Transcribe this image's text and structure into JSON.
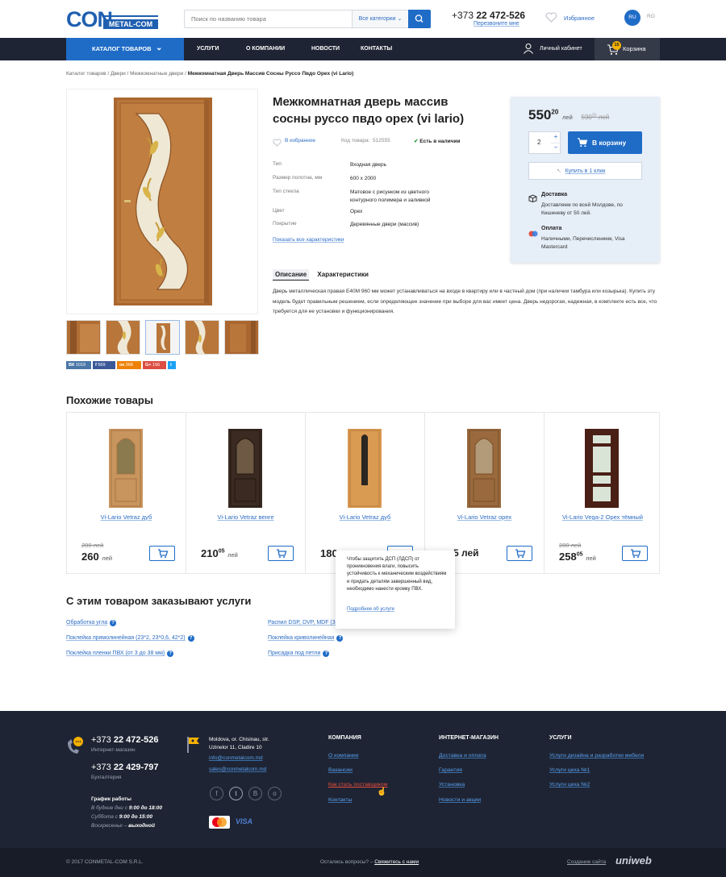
{
  "header": {
    "logo_left": "CON",
    "logo_right": "METAL-COM",
    "search_placeholder": "Поиск по названию товара",
    "search_category": "Все категории",
    "phone_prefix": "+373",
    "phone_number": "22 472-526",
    "callback": "Перезвоните мне",
    "favorites": "Избранное",
    "lang_active": "RU",
    "lang_other": "RO"
  },
  "nav": {
    "catalog": "КАТАЛОГ ТОВАРОВ",
    "items": [
      "УСЛУГИ",
      "О КОМПАНИИ",
      "НОВОСТИ",
      "КОНТАКТЫ"
    ],
    "cabinet": "Личный кабинет",
    "cart": "Корзина",
    "cart_count": "15"
  },
  "breadcrumb": {
    "items": [
      "Каталог товаров",
      "Двери",
      "Межкомнатные двери"
    ],
    "current": "Межкомнатная Дверь Массив Сосны Руссо Пвдо Орех (vi Lario)"
  },
  "social": [
    {
      "label": "ВК",
      "count": "1019",
      "color": "#4a76a8"
    },
    {
      "label": "f",
      "count": "569",
      "color": "#3b5998"
    },
    {
      "label": "ок",
      "count": "368",
      "color": "#ee8208"
    },
    {
      "label": "G+",
      "count": "156",
      "color": "#dc4e41"
    },
    {
      "label": "t",
      "count": "",
      "color": "#1da1f2"
    }
  ],
  "product": {
    "title": "Межкомнатная дверь массив сосны руссо пвдо орех (vi lario)",
    "favorite": "В избранное",
    "code_label": "Код товара:",
    "code": "512555",
    "stock": "Есть в наличии",
    "specs": [
      {
        "label": "Тип",
        "value": "Входная дверь"
      },
      {
        "label": "Размер полотна, мм",
        "value": "600 x 2000"
      },
      {
        "label": "Тип стекла",
        "value": "Матовое с рисунком из цветного контурного полимера и заливкой"
      },
      {
        "label": "Цвет",
        "value": "Орех"
      },
      {
        "label": "Покрытие",
        "value": "Деревянные двери (массив)"
      }
    ],
    "show_all": "Показать все характеристики",
    "tab_desc": "Описание",
    "tab_specs": "Характеристики",
    "description": "Дверь металлическая правая Е40М 960 мм может устанавливаться на входе в квартиру или в частный дом (при наличии тамбура или козырька). Купить эту модель будет правильным решением, если определяющее значение при выборе для вас имеет цена. Дверь недорогая, надежная, в комплекте есть все, что требуется для ее установки и функционирования."
  },
  "buy": {
    "price_int": "550",
    "price_dec": "20",
    "currency": "лей",
    "old_int": "590",
    "old_dec": "20",
    "qty": "2",
    "to_cart": "В корзину",
    "one_click": "Купить в 1 клик",
    "delivery_title": "Доставка",
    "delivery_text": "Доставляем по всей Молдове, по Кишиневу от 50 лей.",
    "payment_title": "Оплата",
    "payment_text": "Наличными, Перечислением, Visa Mastercard"
  },
  "similar": {
    "title": "Похожие товары",
    "items": [
      {
        "name": "Vi-Lario Vetraz дуб",
        "old": "280 лей",
        "price_int": "260",
        "price_dec": "",
        "cur": "лей",
        "color": "#c9955e",
        "glass": "#8a7a4e"
      },
      {
        "name": "Vi-Lario Vetraz венге",
        "old": "",
        "price_int": "210",
        "price_dec": "05",
        "cur": "лей",
        "color": "#3a2a22",
        "glass": "#6e5a44"
      },
      {
        "name": "Vi-Lario Vetraz дуб",
        "old": "",
        "price_int": "180",
        "price_dec": "",
        "cur": "",
        "color": "#d99a52",
        "glass": "#2a2622"
      },
      {
        "name": "Vi-Lario Vetraz орех",
        "old": "",
        "price_int": "",
        "price_dec": "",
        "cur": "",
        "color": "#9a6a3e",
        "glass": "#b39a78"
      },
      {
        "name": "Vi-Lario Vega-2 Орех тёмный",
        "old": "280 лей",
        "price_int": "258",
        "price_dec": "05",
        "cur": "лей",
        "color": "#4a1f16",
        "glass": "#d9e4d6"
      }
    ],
    "partial_price": "5 лей"
  },
  "tooltip": {
    "text": "Чтобы защитить ДСП (ЛДСП) от проникновения влаги, повысить устойчивость к механическим воздействиям и придать деталям завершенный вид, необходимо нанести кромку ПВХ.",
    "link": "Подробнее об услуге"
  },
  "services": {
    "title": "С этим товаром заказывают услуги",
    "left": [
      "Обработка угла",
      "Поклейка прямолинейная (23*2, 23*0,6, 42*2)",
      "Поклейка пленки ПВХ (от 3 до 38 мм)"
    ],
    "right": [
      "Распил DSP, DVP, MDF (3-1",
      "Поклейка криволинейная",
      "Присадка под петли"
    ]
  },
  "footer": {
    "phone1_prefix": "+373",
    "phone1": "22 472-526",
    "phone1_label": "Интернет-магазин",
    "phone2_prefix": "+373",
    "phone2": "22 429-797",
    "phone2_label": "Бухгалтерия",
    "schedule_title": "График работы",
    "schedule": [
      {
        "text": "В будние дни с ",
        "bold": "9:00 до 18:00"
      },
      {
        "text": "Суббота с ",
        "bold": "9:00 до 15:00"
      },
      {
        "text": "Воскресенье – ",
        "bold": "выходной"
      }
    ],
    "address": "Moldova, or. Chisinau, str. Uzinelor 11, Cladire 10",
    "email1": "info@conmetalcom.md",
    "email2": "sales@conmetalcom.md",
    "col1_title": "КОМПАНИЯ",
    "col1": [
      "О компании",
      "Вакансии",
      "Как стать поставщиком",
      "Контакты"
    ],
    "col2_title": "ИНТЕРНЕТ-МАГАЗИН",
    "col2": [
      "Доставка и оплата",
      "Гарантия",
      "Установка",
      "Новости и акции"
    ],
    "col3_title": "УСЛУГИ",
    "col3": [
      "Услуги дизайна и разработки мебели",
      "Услуги цеха №1",
      "Услуги цеха №2"
    ],
    "copyright": "© 2017 CONMETAL-COM S.R.L.",
    "question": "Остались вопросы? –",
    "contact_us": "Свяжитесь с нами",
    "made_by": "Создание сайта",
    "studio": "uniweb",
    "visa": "VISA",
    "mastercard": "MasterCard"
  },
  "colors": {
    "accent": "#1f6cc7",
    "nav": "#1e2433",
    "footer": "#1e2433",
    "link": "#2c6cc4",
    "stock": "#2a9d3c"
  }
}
